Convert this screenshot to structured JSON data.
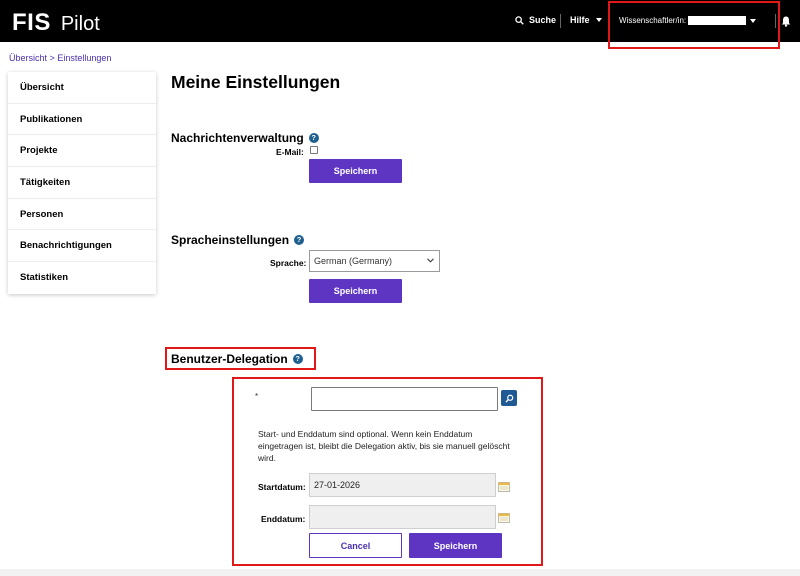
{
  "header": {
    "brand": "FIS",
    "product": "Pilot",
    "search_label": "Suche",
    "help_label": "Hilfe",
    "user_label": "Wissenschaftler/in:",
    "colors": {
      "bar": "#000000",
      "highlight": "#e01818"
    }
  },
  "breadcrumb": {
    "items": [
      "Übersicht",
      "Einstellungen"
    ],
    "separator": ">"
  },
  "sidebar": {
    "items": [
      {
        "label": "Übersicht"
      },
      {
        "label": "Publikationen"
      },
      {
        "label": "Projekte"
      },
      {
        "label": "Tätigkeiten"
      },
      {
        "label": "Personen"
      },
      {
        "label": "Benachrichtigungen"
      },
      {
        "label": "Statistiken"
      }
    ]
  },
  "page": {
    "title": "Meine Einstellungen"
  },
  "notifications": {
    "title": "Nachrichtenverwaltung",
    "email_label": "E-Mail:",
    "email_checked": false,
    "save_label": "Speichern"
  },
  "language": {
    "title": "Spracheinstellungen",
    "label": "Sprache:",
    "selected": "German (Germany)",
    "save_label": "Speichern"
  },
  "delegation": {
    "title": "Benutzer-Delegation",
    "required_marker": "*",
    "user_search_value": "",
    "info": "Start- und Enddatum sind optional. Wenn kein Enddatum eingetragen ist, bleibt die Delegation aktiv, bis sie manuell gelöscht wird.",
    "start_label": "Startdatum:",
    "start_value": "27-01-2026",
    "end_label": "Enddatum:",
    "end_value": "",
    "cancel_label": "Cancel",
    "save_label": "Speichern"
  },
  "colors": {
    "primary": "#5e35c2",
    "link": "#4a2fb0",
    "help_icon": "#1d5f8f"
  }
}
